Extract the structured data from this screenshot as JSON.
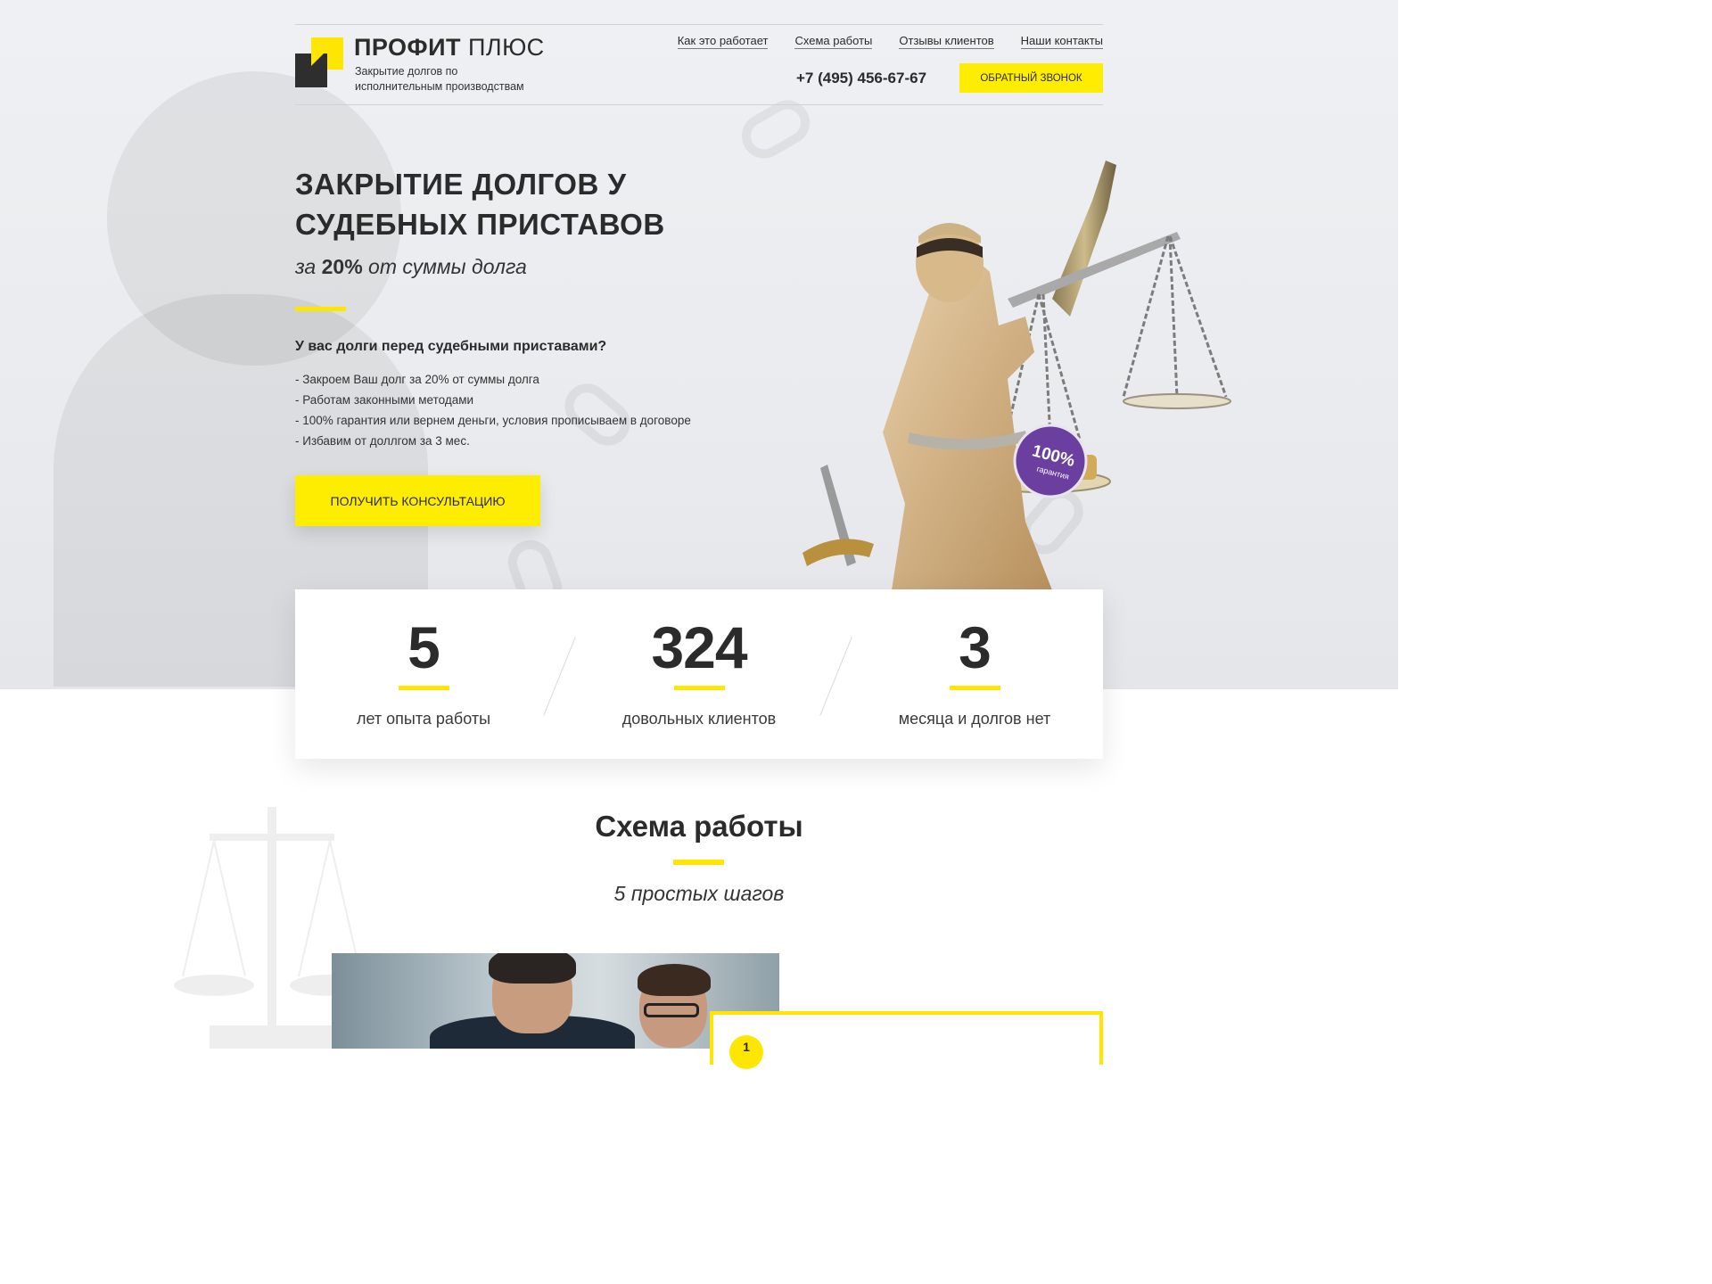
{
  "brand": {
    "name_bold": "ПРОФИТ",
    "name_light": " ПЛЮС",
    "tagline": "Закрытие долгов по исполнительным производствам"
  },
  "nav": [
    {
      "label": "Как это работает"
    },
    {
      "label": "Схема работы"
    },
    {
      "label": "Отзывы клиентов"
    },
    {
      "label": "Наши контакты"
    }
  ],
  "header": {
    "phone": "+7 (495) 456-67-67",
    "callback_label": "Обратный звонок"
  },
  "hero": {
    "title": "Закрытие долгов у судебных приставов",
    "sub_prefix": "за ",
    "sub_bold": "20%",
    "sub_suffix": " от суммы долга",
    "question": "У вас долги перед судебными приставами?",
    "bullets": [
      "- Закроем Ваш долг за 20% от суммы долга",
      "- Работам законными методами",
      "- 100% гарантия или вернем деньги, условия прописываем в договоре",
      "- Избавим от доллгом за 3 мес."
    ],
    "cta_label": "Получить консультацию",
    "badge_main": "100%",
    "badge_sub": "гарантия"
  },
  "stats": [
    {
      "value": "5",
      "label": "лет опыта работы"
    },
    {
      "value": "324",
      "label": "довольных клиентов"
    },
    {
      "value": "3",
      "label": "месяца и долгов нет"
    }
  ],
  "scheme": {
    "title": "Схема работы",
    "subtitle": "5 простых шагов",
    "first_step_number": "1"
  },
  "colors": {
    "accent": "#ffe600",
    "text": "#2b2b2b",
    "badge": "#6a3fa0"
  }
}
